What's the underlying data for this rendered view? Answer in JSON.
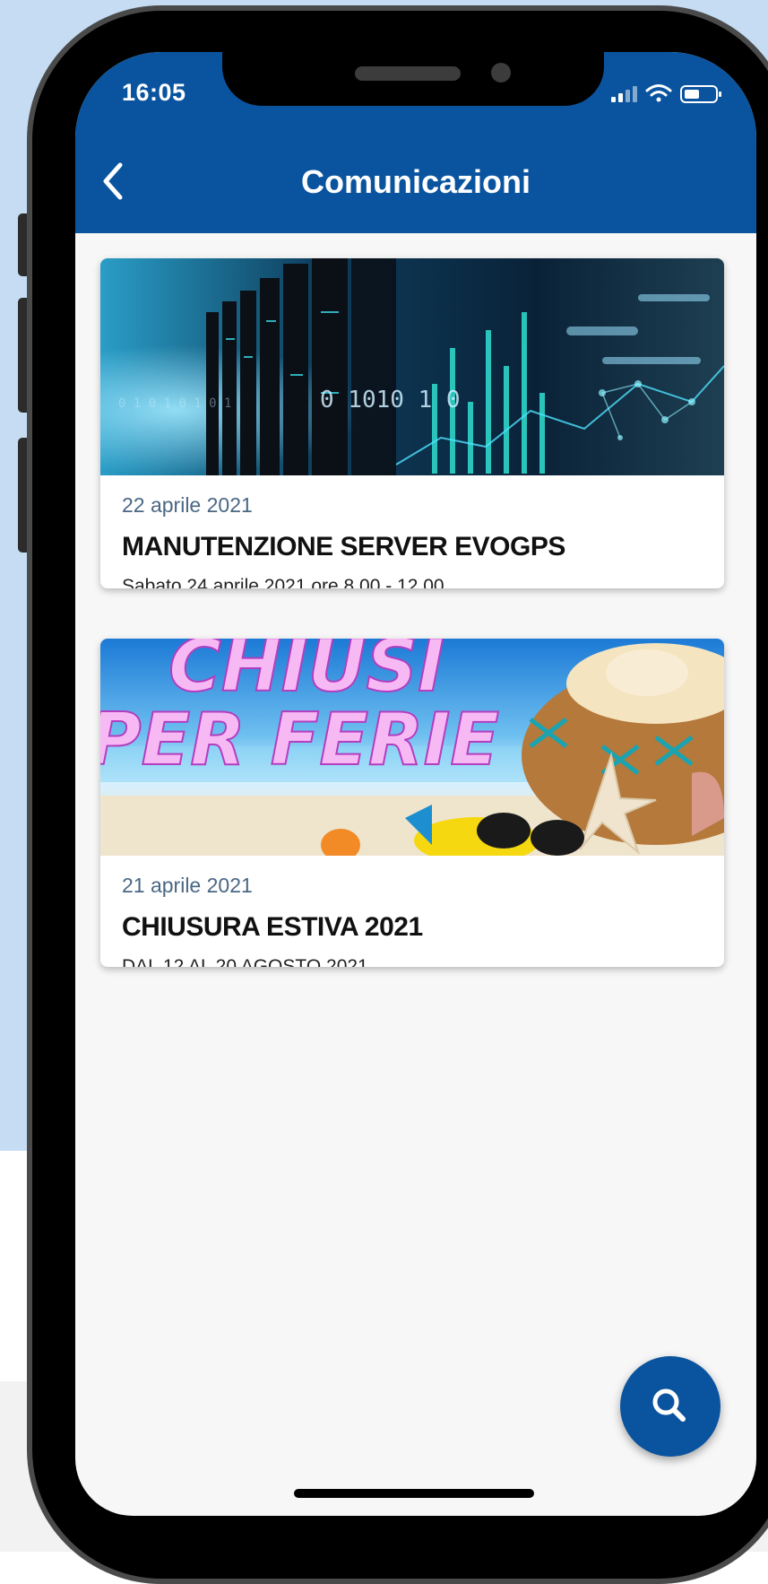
{
  "status_bar": {
    "time": "16:05"
  },
  "header": {
    "title": "Comunicazioni"
  },
  "communications": [
    {
      "date": "22 aprile 2021",
      "title": "MANUTENZIONE SERVER EVOGPS",
      "subtitle": "Sabato 24 aprile 2021 ore 8.00 - 12.00",
      "image": {
        "overlay_text": "0 1010 1 0"
      }
    },
    {
      "date": "21 aprile 2021",
      "title": "CHIUSURA ESTIVA 2021",
      "subtitle": "DAL 12 AL 20 AGOSTO 2021",
      "image": {
        "line1": "CHIUSI",
        "line2": "PER FERIE"
      }
    }
  ],
  "icons": {
    "back": "chevron-left-icon",
    "search": "search-icon",
    "wifi": "wifi-icon",
    "signal": "signal-icon",
    "battery": "battery-icon"
  },
  "colors": {
    "primary": "#0a549f",
    "background": "#f7f7f7",
    "date_text": "#4a6784"
  }
}
